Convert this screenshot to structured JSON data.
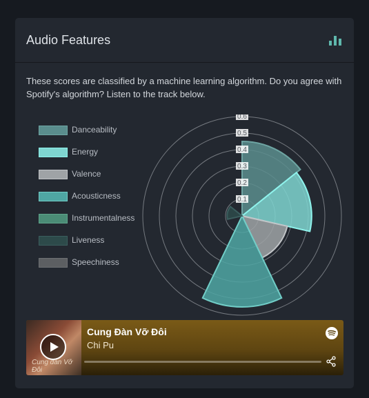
{
  "header": {
    "title": "Audio Features",
    "icon": "bar-chart-icon"
  },
  "description": "These scores are classified by a machine learning algorithm. Do you agree with Spotify's algorithm? Listen to the track below.",
  "chart_data": {
    "type": "polarArea",
    "categories": [
      "Danceability",
      "Energy",
      "Valence",
      "Acousticness",
      "Instrumentalness",
      "Liveness",
      "Speechiness"
    ],
    "values": [
      0.45,
      0.42,
      0.28,
      0.55,
      0.0,
      0.09,
      0.0
    ],
    "r_ticks": [
      "0",
      "0.1",
      "0.2",
      "0.3",
      "0.4",
      "0.5",
      "0.6"
    ],
    "rlim": [
      0,
      0.6
    ],
    "legend_position": "left",
    "colors": {
      "fills": [
        "#5a8d8d",
        "#7fd5d0",
        "#9fa3a6",
        "#4fa6a3",
        "#4b8c76",
        "#2d4a4a",
        "#5c5f62"
      ],
      "borders": [
        "#6ea5a3",
        "#8ff3ec",
        "#c2c5c8",
        "#71cdc7",
        "#5fa58b",
        "#3b5e5e",
        "#6e7174"
      ],
      "grid": "#b9bdc2"
    }
  },
  "player": {
    "track_title": "Cung Đàn Vỡ Đôi",
    "artist": "Chi Pu",
    "album_art_text": "Cung đàn Vỡ Đôi",
    "play_icon": "play-icon",
    "spotify_icon": "spotify-icon",
    "share_icon": "share-icon"
  }
}
